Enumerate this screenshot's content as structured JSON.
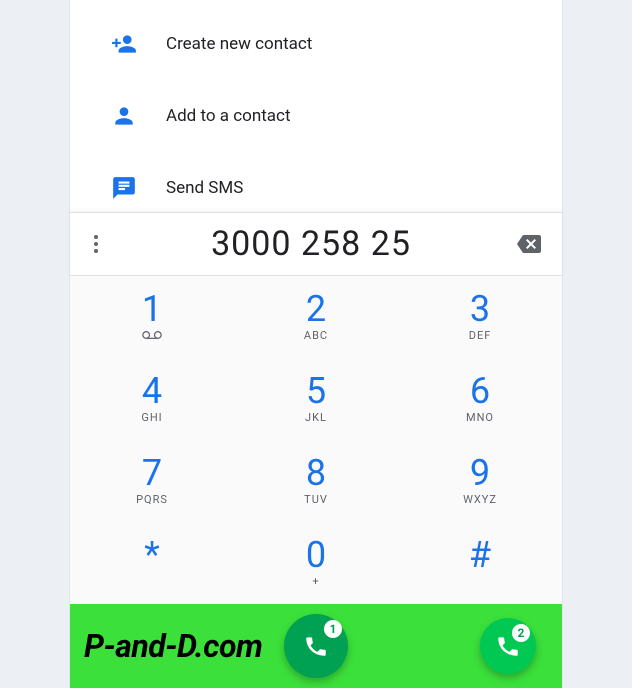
{
  "actions": {
    "create": "Create new contact",
    "add": "Add to a contact",
    "sms": "Send SMS"
  },
  "dialed_number": "3000 258 25",
  "keys": [
    {
      "digit": "1",
      "sub": ""
    },
    {
      "digit": "2",
      "sub": "ABC"
    },
    {
      "digit": "3",
      "sub": "DEF"
    },
    {
      "digit": "4",
      "sub": "GHI"
    },
    {
      "digit": "5",
      "sub": "JKL"
    },
    {
      "digit": "6",
      "sub": "MNO"
    },
    {
      "digit": "7",
      "sub": "PQRS"
    },
    {
      "digit": "8",
      "sub": "TUV"
    },
    {
      "digit": "9",
      "sub": "WXYZ"
    },
    {
      "digit": "*",
      "sub": ""
    },
    {
      "digit": "0",
      "sub": "+"
    },
    {
      "digit": "#",
      "sub": ""
    }
  ],
  "fab": {
    "main_badge": "1",
    "small_badge": "2"
  },
  "brand": "P-and-D.com"
}
